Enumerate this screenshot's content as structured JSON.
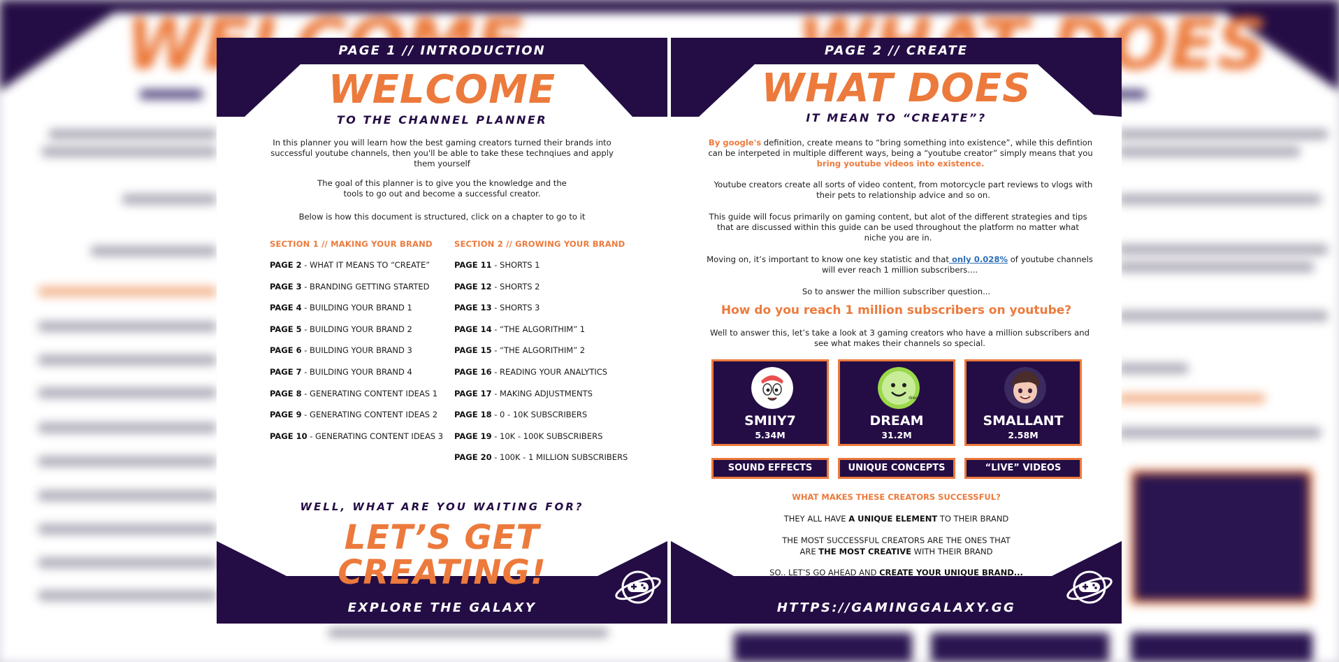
{
  "background": {
    "big_left": "WELCOME",
    "big_right": "WHAT DOES"
  },
  "page1": {
    "top_label": "PAGE 1 // INTRODUCTION",
    "title": "WELCOME",
    "subtitle": "TO THE CHANNEL PLANNER",
    "paragraphs": [
      "In this planner you will learn how the best gaming creators turned their brands into successful youtube channels, then you'll be able to take these technqiues and apply them yourself",
      "The goal of this planner is to give you the knowledge and the tools to go out and become a successful creator.",
      "Below is how this document is structured, click on a chapter to go to it"
    ],
    "section1": {
      "title": "SECTION 1 // MAKING YOUR BRAND",
      "items": [
        {
          "page": "PAGE 2",
          "text": " - WHAT IT MEANS TO “CREATE”"
        },
        {
          "page": "PAGE 3",
          "text": " - BRANDING GETTING STARTED"
        },
        {
          "page": "PAGE 4",
          "text": " - BUILDING YOUR BRAND 1"
        },
        {
          "page": "PAGE 5",
          "text": " - BUILDING YOUR BRAND 2"
        },
        {
          "page": "PAGE 6",
          "text": " - BUILDING YOUR BRAND 3"
        },
        {
          "page": "PAGE 7",
          "text": " - BUILDING YOUR BRAND 4"
        },
        {
          "page": "PAGE 8",
          "text": " - GENERATING CONTENT IDEAS 1"
        },
        {
          "page": "PAGE 9",
          "text": " - GENERATING CONTENT IDEAS 2"
        },
        {
          "page": "PAGE 10",
          "text": " - GENERATING CONTENT IDEAS 3"
        }
      ]
    },
    "section2": {
      "title": "SECTION 2 // GROWING YOUR BRAND",
      "items": [
        {
          "page": "PAGE 11",
          "text": " - SHORTS 1"
        },
        {
          "page": "PAGE 12",
          "text": " - SHORTS 2"
        },
        {
          "page": "PAGE 13",
          "text": " - SHORTS 3"
        },
        {
          "page": "PAGE 14",
          "text": " - “THE ALGORITHIM” 1"
        },
        {
          "page": "PAGE 15",
          "text": " - “THE ALGORITHIM” 2"
        },
        {
          "page": "PAGE 16",
          "text": " - READING YOUR ANALYTICS"
        },
        {
          "page": "PAGE 17",
          "text": " - MAKING ADJUSTMENTS"
        },
        {
          "page": "PAGE 18",
          "text": " - 0 - 10K SUBSCRIBERS"
        },
        {
          "page": "PAGE 19",
          "text": " - 10K - 100K SUBSCRIBERS"
        },
        {
          "page": "PAGE 20",
          "text": " - 100K - 1 MILLION SUBSCRIBERS"
        }
      ]
    },
    "waiting": "WELL, WHAT ARE YOU WAITING FOR?",
    "cta_line1": "LET’S GET",
    "cta_line2": "CREATING!",
    "bottom_label": "EXPLORE THE GALAXY",
    "logo_icon": "gamepad-planet-icon"
  },
  "page2": {
    "top_label": "PAGE 2 // CREATE",
    "title": "WHAT DOES",
    "subtitle": "IT MEAN TO “CREATE”?",
    "p1_a": "By google's",
    "p1_b": " definition, create means to “bring something into existence”, while this defintion can be interpeted in multiple different ways, being a “youtube creator” simply means that you ",
    "p1_c": "bring youtube videos into existence.",
    "p2": "Youtube creators create all sorts of video content, from motorcycle part reviews to vlogs with their pets to relationship advice and so on.",
    "p3": "This guide will focus primarily on gaming content, but alot of the different strategies and tips that are discussed within this guide can be used throughout the platform no matter what niche you are in.",
    "p4_a": "Moving on, it’s important to know one key statistic and that",
    "p4_link": " only 0.028%",
    "p4_b": " of youtube channels will ever reach 1 million subscribers....",
    "p5": "So to answer the million subscriber question...",
    "question": "How do you reach 1 million subscribers on youtube?",
    "p6": "Well to answer this, let’s take a look at 3 gaming creators who have a million subscribers and see what makes their channels so special.",
    "creators": [
      {
        "name": "SMIIY7",
        "subs": "5.34M",
        "trait": "SOUND EFFECTS"
      },
      {
        "name": "DREAM",
        "subs": "31.2M",
        "trait": "UNIQUE CONCEPTS"
      },
      {
        "name": "SMALLANT",
        "subs": "2.58M",
        "trait": "“LIVE” VIDEOS"
      }
    ],
    "success_title": "WHAT MAKES THESE CREATORS SUCCESSFUL?",
    "line1_a": "THEY ALL HAVE ",
    "line1_b": "A UNIQUE ELEMENT",
    "line1_c": " TO THEIR BRAND",
    "line2_a": "THE MOST SUCCESSFUL CREATORS ARE THE ONES THAT ARE ",
    "line2_b": "THE MOST CREATIVE",
    "line2_c": " WITH THEIR BRAND",
    "line3_a": "SO.. LET’S GO AHEAD AND ",
    "line3_b": "CREATE YOUR UNIQUE BRAND...",
    "bottom_label": "HTTPS://GAMINGGALAXY.GG",
    "logo_icon": "gamepad-planet-icon"
  },
  "colors": {
    "navy": "#240d45",
    "orange": "#ec7a3c",
    "link": "#2f6fb8"
  }
}
